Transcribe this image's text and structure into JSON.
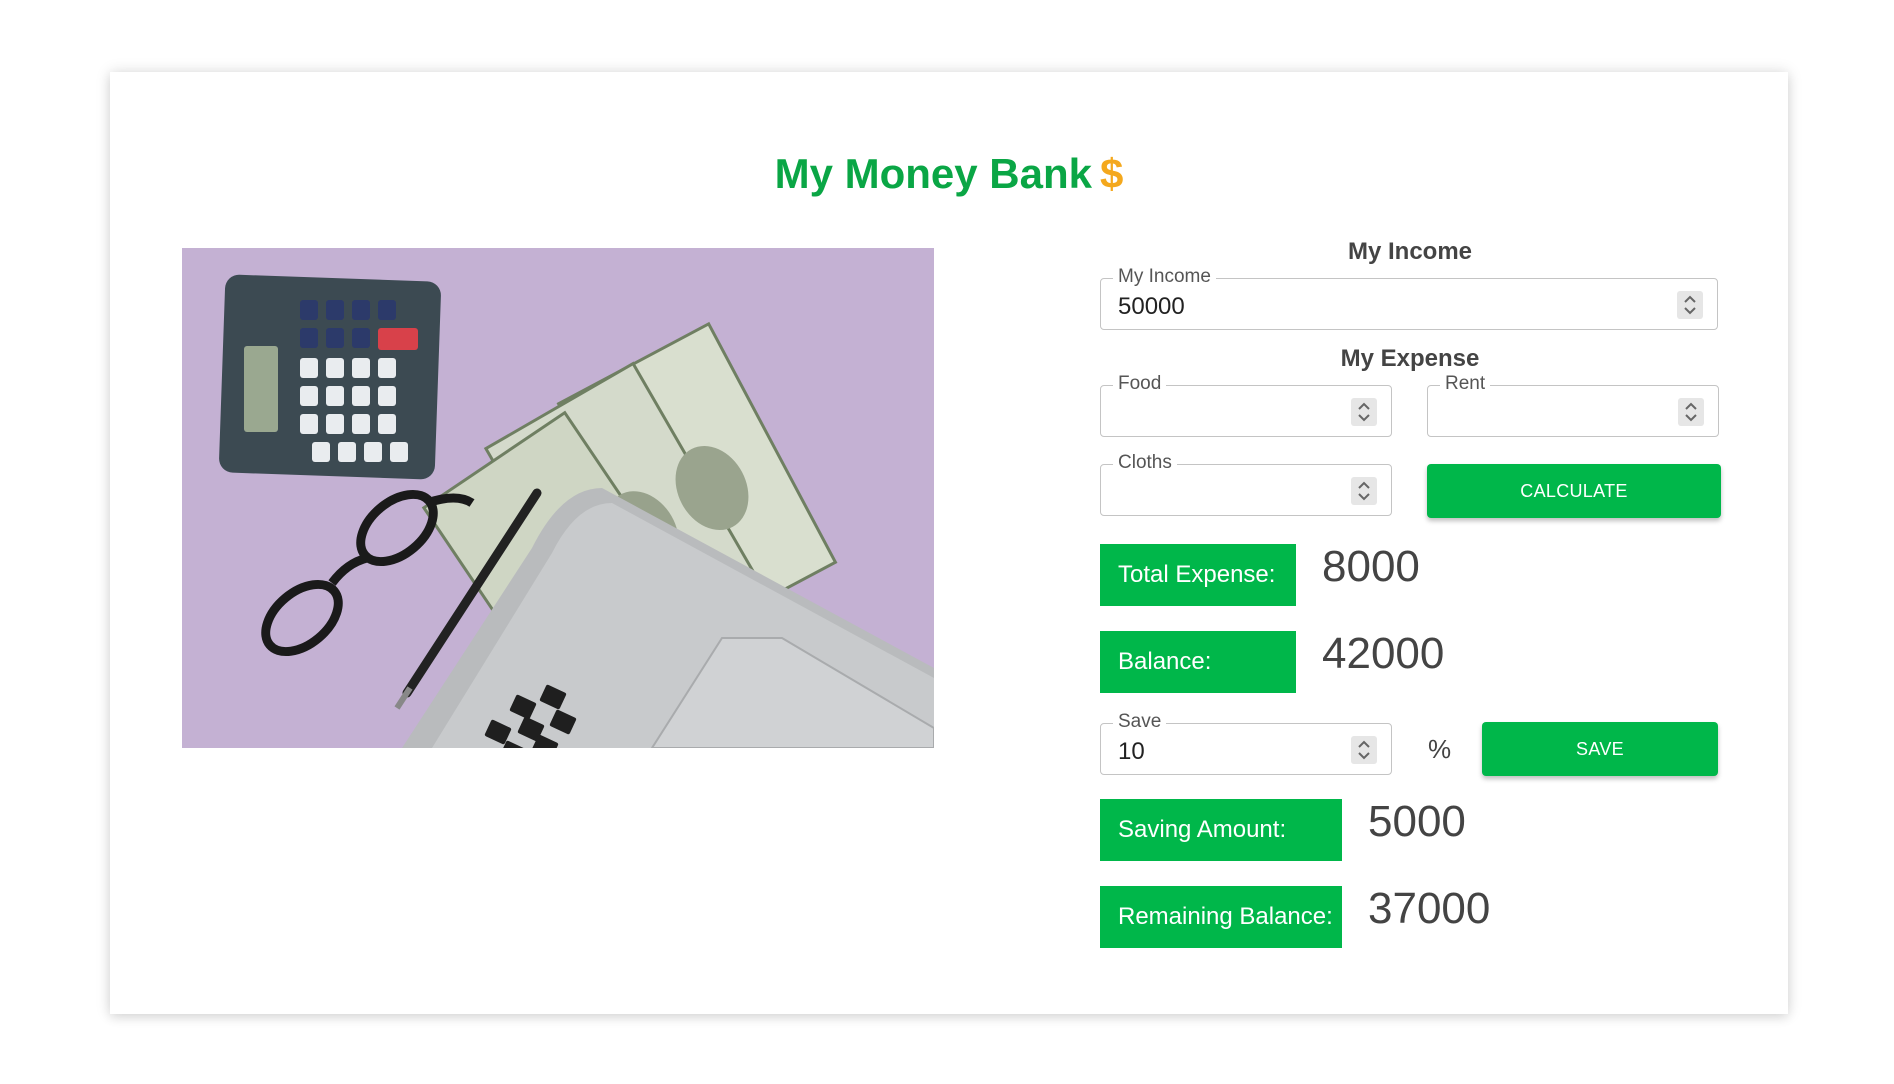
{
  "header": {
    "title": "My Money Bank",
    "symbol": "$"
  },
  "income_section": {
    "heading": "My Income",
    "income_field": {
      "label": "My Income",
      "value": "50000"
    }
  },
  "expense_section": {
    "heading": "My Expense",
    "food": {
      "label": "Food",
      "value": ""
    },
    "rent": {
      "label": "Rent",
      "value": ""
    },
    "cloths": {
      "label": "Cloths",
      "value": ""
    },
    "calculate_label": "CALCULATE"
  },
  "results": {
    "total_expense_label": "Total Expense:",
    "total_expense_value": "8000",
    "balance_label": "Balance:",
    "balance_value": "42000"
  },
  "saving": {
    "save_field": {
      "label": "Save",
      "value": "10"
    },
    "percent_sign": "%",
    "save_label": "SAVE",
    "saving_amount_label": "Saving Amount:",
    "saving_amount_value": "5000",
    "remaining_label": "Remaining Balance:",
    "remaining_value": "37000"
  },
  "colors": {
    "brand": "#0aa645",
    "button": "#00b74a",
    "dollar": "#f4a81d"
  }
}
